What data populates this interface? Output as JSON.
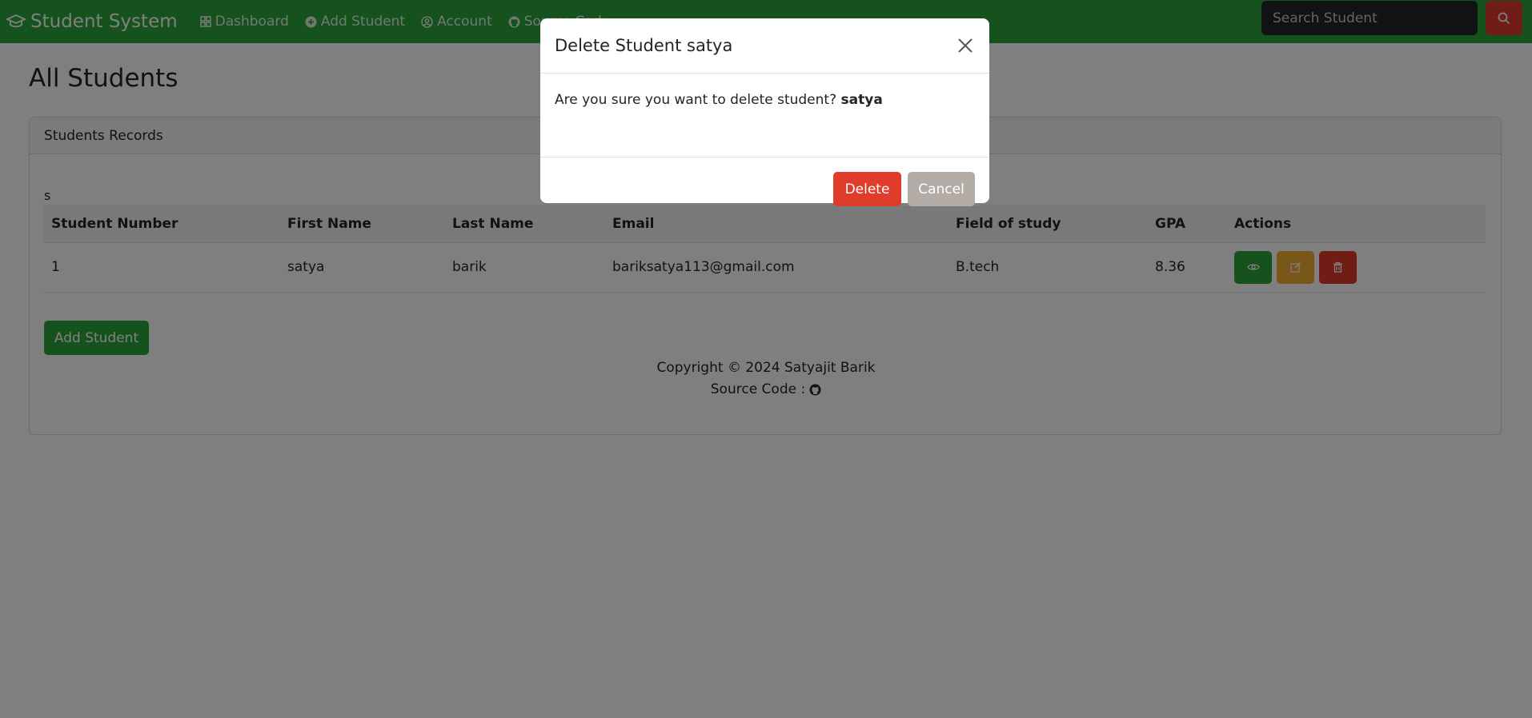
{
  "app": {
    "title": "Student System"
  },
  "navbar": {
    "items": [
      {
        "label": "Dashboard",
        "icon": "dashboard-icon"
      },
      {
        "label": "Add Student",
        "icon": "plus-circle-icon"
      },
      {
        "label": "Account",
        "icon": "user-circle-icon"
      },
      {
        "label": "Source Code",
        "icon": "github-icon"
      }
    ],
    "search": {
      "placeholder": "Search Student",
      "icon": "search-icon"
    }
  },
  "page": {
    "title": "All Students"
  },
  "card": {
    "header": "Students Records",
    "stray_text": "s",
    "table": {
      "columns": [
        "Student Number",
        "First Name",
        "Last Name",
        "Email",
        "Field of study",
        "GPA",
        "Actions"
      ],
      "rows": [
        {
          "student_number": "1",
          "first_name": "satya",
          "last_name": "barik",
          "email": "bariksatya113@gmail.com",
          "field": "B.tech",
          "gpa": "8.36"
        }
      ],
      "actions": [
        "eye-icon",
        "edit-icon",
        "trash-icon"
      ]
    },
    "add_button": "Add Student",
    "footer": {
      "copyright": "Copyright © 2024 Satyajit Barik",
      "source_label": "Source Code :",
      "source_icon": "github-icon"
    }
  },
  "modal": {
    "title": "Delete Student satya",
    "body_prefix": "Are you sure you want to delete student?",
    "body_name": "satya",
    "delete_label": "Delete",
    "cancel_label": "Cancel"
  },
  "colors": {
    "primary": "#2ca53a",
    "danger": "#e03c2b",
    "warning": "#f0ad2e",
    "secondary": "#b3aca6",
    "dark": "#212529"
  }
}
